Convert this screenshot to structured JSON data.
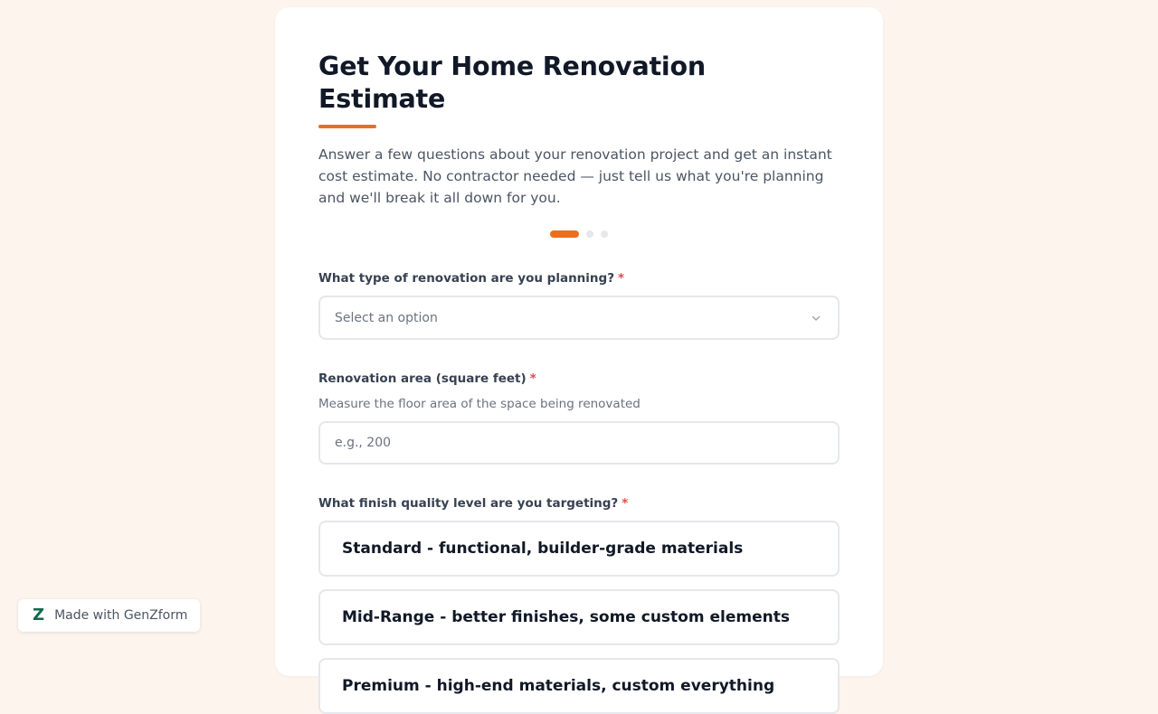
{
  "form": {
    "title": "Get Your Home Renovation Estimate",
    "description": "Answer a few questions about your renovation project and get an instant cost estimate. No contractor needed — just tell us what you're planning and we'll break it all down for you.",
    "progress": {
      "current_step": 1,
      "total_steps": 3
    },
    "accent_color": "#ea6f1f"
  },
  "questions": {
    "renovation_type": {
      "label": "What type of renovation are you planning?",
      "required_mark": "*",
      "selected_value": "Select an option"
    },
    "area": {
      "label": "Renovation area (square feet)",
      "required_mark": "*",
      "helper": "Measure the floor area of the space being renovated",
      "placeholder": "e.g., 200",
      "value": ""
    },
    "finish_quality": {
      "label": "What finish quality level are you targeting?",
      "required_mark": "*",
      "options": [
        "Standard - functional, builder-grade materials",
        "Mid-Range - better finishes, some custom elements",
        "Premium - high-end materials, custom everything"
      ]
    }
  },
  "badge": {
    "logo": "Z",
    "text": "Made with GenZform",
    "logo_color": "#0f6b4a"
  },
  "icons": {
    "select_chevron": "chevron-down-icon",
    "badge_logo": "genzform-logo-icon"
  }
}
